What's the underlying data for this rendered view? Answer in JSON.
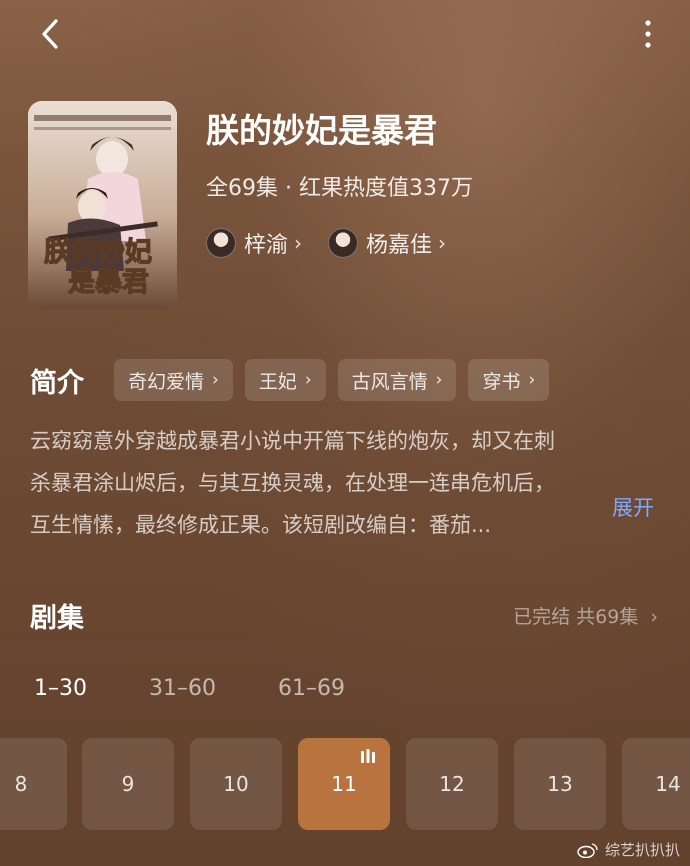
{
  "header": {
    "back_icon": "chevron-left-icon",
    "more_icon": "more-vertical-icon"
  },
  "drama": {
    "title": "朕的妙妃是暴君",
    "poster_title": "朕的妙妃是暴君",
    "meta": "全69集 · 红果热度值337万",
    "actors": [
      {
        "name": "梓渝"
      },
      {
        "name": "杨嘉佳"
      }
    ]
  },
  "intro": {
    "label": "简介",
    "tags": [
      "奇幻爱情",
      "王妃",
      "古风言情",
      "穿书"
    ],
    "description_lines": [
      "云窈窈意外穿越成暴君小说中开篇下线的炮灰，却又在刺",
      "杀暴君涂山烬后，与其互换灵魂，在处理一连串危机后，",
      "互生情愫，最终修成正果。该短剧改编自：番茄..."
    ],
    "expand_label": "展开"
  },
  "episodes": {
    "label": "剧集",
    "status": "已完结 共69集",
    "ranges": [
      "1–30",
      "31–60",
      "61–69"
    ],
    "active_range": "1–30",
    "items": [
      "8",
      "9",
      "10",
      "11",
      "12",
      "13",
      "14"
    ],
    "active_item": "11"
  },
  "watermark": {
    "text": "综艺扒扒扒"
  },
  "colors": {
    "accent_episode": "#b8733f",
    "expand_link": "#7fa8ff",
    "background": "#6e4a33"
  }
}
